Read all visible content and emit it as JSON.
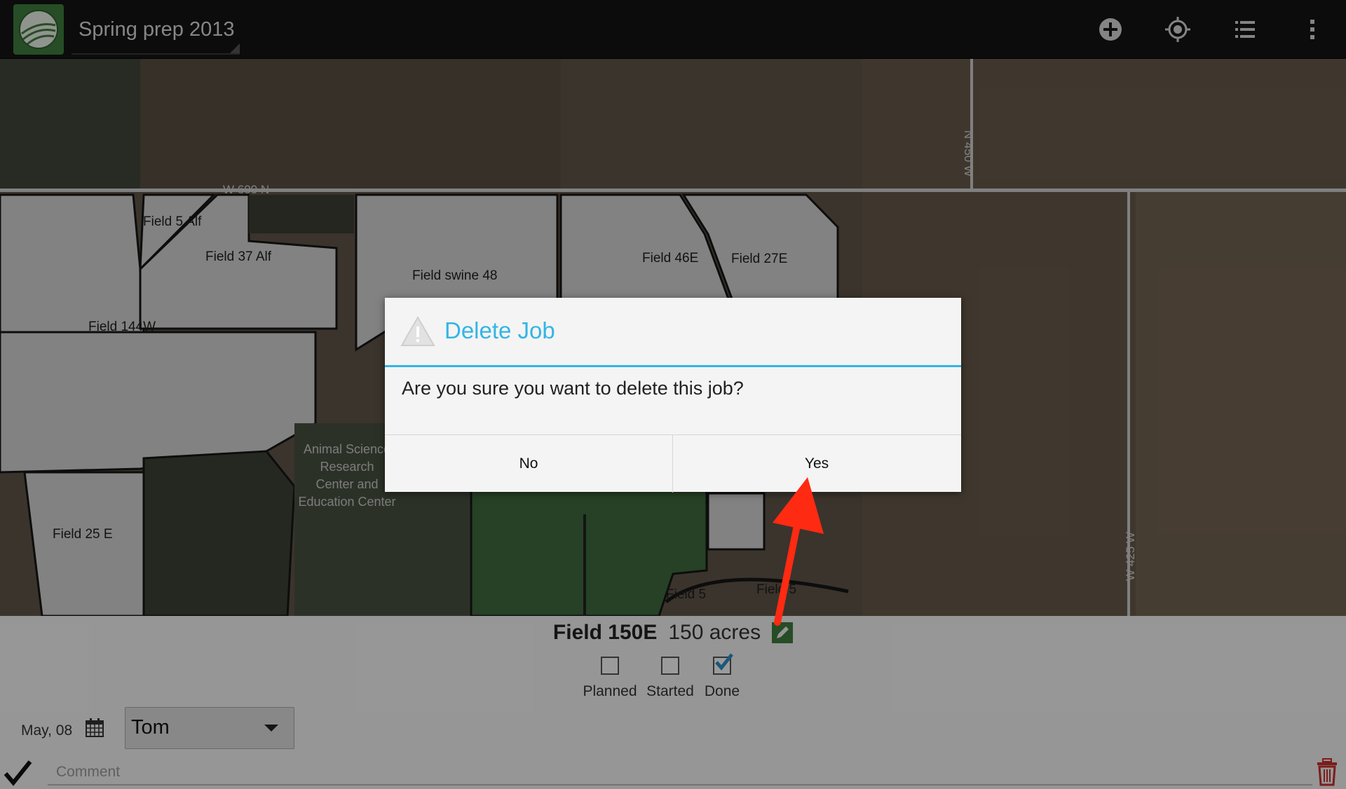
{
  "actionbar": {
    "title": "Spring prep 2013",
    "icons": [
      "app-logo",
      "add-icon",
      "locate-icon",
      "list-icon",
      "overflow-menu-icon"
    ]
  },
  "map": {
    "field_labels": [
      "Field 5 Alf",
      "Field 37 Alf",
      "Field swine 48",
      "Field 46E",
      "Field 27E",
      "Field 144W",
      "Field 25 E",
      "Field 5",
      "Field 5"
    ],
    "poi_label": [
      "Animal Science",
      "Research",
      "Center and",
      "Education Center"
    ],
    "road_labels": [
      "W 600 N",
      "N 450 W",
      "W 425 W"
    ]
  },
  "panel": {
    "field_name": "Field 150E",
    "field_area": "150 acres",
    "statuses": [
      {
        "label": "Planned",
        "checked": false
      },
      {
        "label": "Started",
        "checked": false
      },
      {
        "label": "Done",
        "checked": true
      }
    ],
    "date": "May, 08",
    "user": "Tom",
    "comment_placeholder": "Comment"
  },
  "dialog": {
    "title": "Delete Job",
    "message": "Are you sure you want to delete this job?",
    "no_label": "No",
    "yes_label": "Yes"
  },
  "colors": {
    "accent": "#33b5e5",
    "selected_field": "#3e6a3c",
    "annotation_arrow": "#ff2a12"
  }
}
